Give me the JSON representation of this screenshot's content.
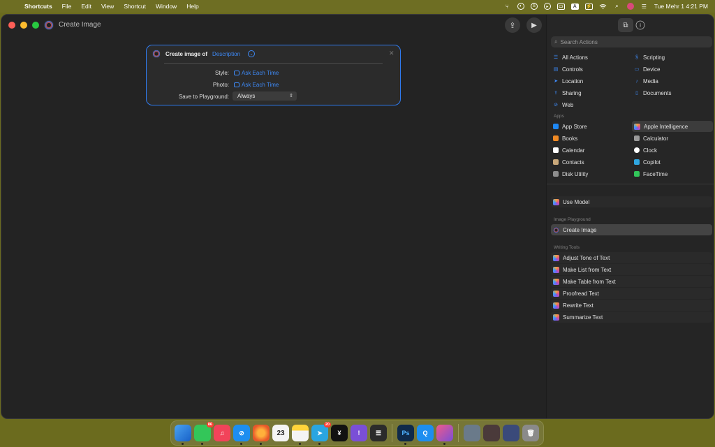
{
  "menubar": {
    "apple": "",
    "items": [
      "Shortcuts",
      "File",
      "Edit",
      "View",
      "Shortcut",
      "Window",
      "Help"
    ],
    "status": {
      "input_source": "A",
      "battery_symbol": "⚡",
      "clock": "Tue Mehr 1  4:21 PM"
    }
  },
  "window": {
    "title": "Create Image"
  },
  "action_card": {
    "title": "Create image of",
    "parameter": "Description",
    "rows": [
      {
        "label": "Style:",
        "value": "Ask Each Time"
      },
      {
        "label": "Photo:",
        "value": "Ask Each Time"
      },
      {
        "label": "Save to Playground:",
        "value": "Always"
      }
    ]
  },
  "sidebar": {
    "search_placeholder": "Search Actions",
    "categories": [
      {
        "label": "All Actions",
        "icon": "list-icon"
      },
      {
        "label": "Scripting",
        "icon": "scripting-icon"
      },
      {
        "label": "Controls",
        "icon": "controls-icon"
      },
      {
        "label": "Device",
        "icon": "device-icon"
      },
      {
        "label": "Location",
        "icon": "location-icon"
      },
      {
        "label": "Media",
        "icon": "music-note-icon"
      },
      {
        "label": "Sharing",
        "icon": "share-icon"
      },
      {
        "label": "Documents",
        "icon": "document-icon"
      },
      {
        "label": "Web",
        "icon": "compass-icon"
      }
    ],
    "apps_label": "Apps",
    "apps": [
      {
        "label": "App Store",
        "color": "#1e88f5"
      },
      {
        "label": "Apple Intelligence",
        "color": "#e14f8a"
      },
      {
        "label": "Books",
        "color": "#f08a24"
      },
      {
        "label": "Calculator",
        "color": "#9a9a9a"
      },
      {
        "label": "Calendar",
        "color": "#ffffff"
      },
      {
        "label": "Clock",
        "color": "#ffffff"
      },
      {
        "label": "Contacts",
        "color": "#c9a87a"
      },
      {
        "label": "Copilot",
        "color": "#2fa6e0"
      },
      {
        "label": "Disk Utility",
        "color": "#8d8d8d"
      },
      {
        "label": "FaceTime",
        "color": "#32c65a"
      }
    ],
    "use_model": "Use Model",
    "image_playground_label": "Image Playground",
    "create_image": "Create Image",
    "writing_tools_label": "Writing Tools",
    "writing_tools": [
      "Adjust Tone of Text",
      "Make List from Text",
      "Make Table from Text",
      "Proofread Text",
      "Rewrite Text",
      "Summarize Text"
    ]
  },
  "dock": {
    "messages_badge": "86",
    "calendar_day": "23",
    "telegram_badge": "20",
    "photoshop_label": "Ps"
  }
}
